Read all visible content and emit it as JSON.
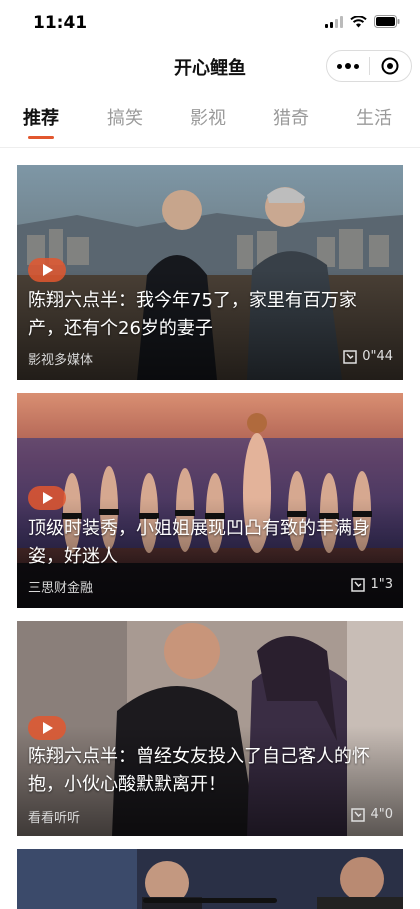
{
  "status": {
    "time": "11:41"
  },
  "nav": {
    "title": "开心鲤鱼"
  },
  "tabs": [
    {
      "label": "推荐",
      "active": true
    },
    {
      "label": "搞笑",
      "active": false
    },
    {
      "label": "影视",
      "active": false
    },
    {
      "label": "猎奇",
      "active": false
    },
    {
      "label": "生活",
      "active": false
    }
  ],
  "cards": [
    {
      "title": "陈翔六点半：我今年75了，家里有百万家产，还有个26岁的妻子",
      "source": "影视多媒体",
      "duration": "0\"44"
    },
    {
      "title": "顶级时装秀，小姐姐展现凹凸有致的丰满身姿，好迷人",
      "source": "三思财金融",
      "duration": "1\"3"
    },
    {
      "title": "陈翔六点半：曾经女友投入了自己客人的怀抱，小伙心酸默默离开！",
      "source": "看看听听",
      "duration": "4\"0"
    }
  ],
  "colors": {
    "accent": "#e2572f",
    "active_tab": "#111111",
    "inactive_tab": "#9a9a9a"
  }
}
